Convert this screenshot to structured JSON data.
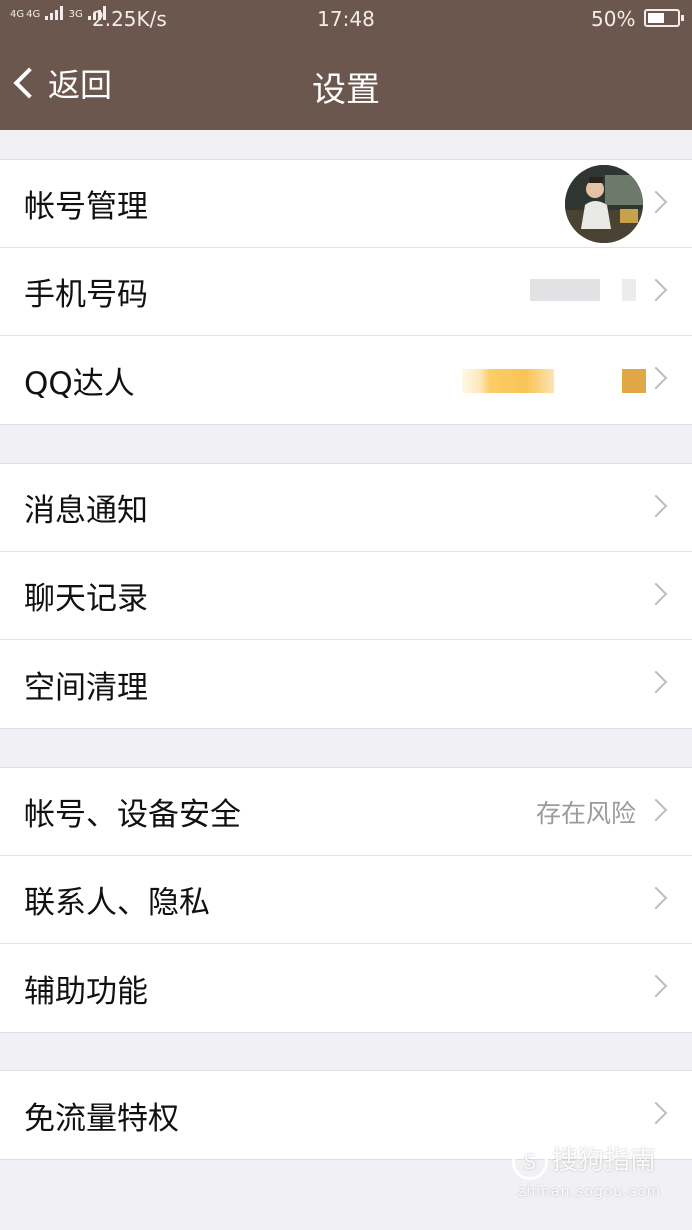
{
  "status_bar": {
    "network_1": "4G",
    "network_2": "4G",
    "network_3": "3G",
    "speed": "2.25K/s",
    "time": "17:48",
    "battery": "50%"
  },
  "nav": {
    "back_label": "返回",
    "title": "设置"
  },
  "groups": [
    {
      "items": [
        {
          "label": "帐号管理",
          "value": ""
        },
        {
          "label": "手机号码",
          "value": ""
        },
        {
          "label": "QQ达人",
          "value": ""
        }
      ]
    },
    {
      "items": [
        {
          "label": "消息通知",
          "value": ""
        },
        {
          "label": "聊天记录",
          "value": ""
        },
        {
          "label": "空间清理",
          "value": ""
        }
      ]
    },
    {
      "items": [
        {
          "label": "帐号、设备安全",
          "value": "存在风险"
        },
        {
          "label": "联系人、隐私",
          "value": ""
        },
        {
          "label": "辅助功能",
          "value": ""
        }
      ]
    },
    {
      "items": [
        {
          "label": "免流量特权",
          "value": ""
        }
      ]
    }
  ],
  "watermark": {
    "logo": "S",
    "text": "搜狗指南",
    "url": "zhinan.sogou.com"
  },
  "colors": {
    "header_bg": "#6b574d",
    "page_bg": "#f1f0f5"
  }
}
